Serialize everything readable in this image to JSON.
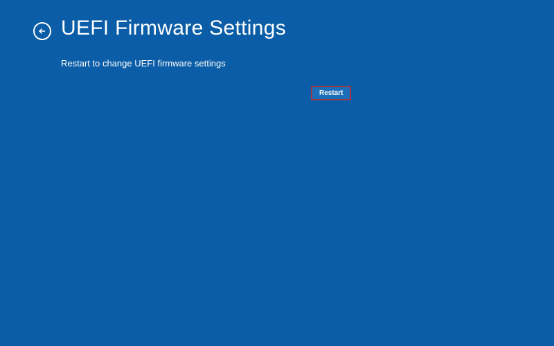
{
  "header": {
    "title": "UEFI Firmware Settings"
  },
  "content": {
    "description": "Restart to change UEFI firmware settings"
  },
  "actions": {
    "restart_label": "Restart"
  }
}
